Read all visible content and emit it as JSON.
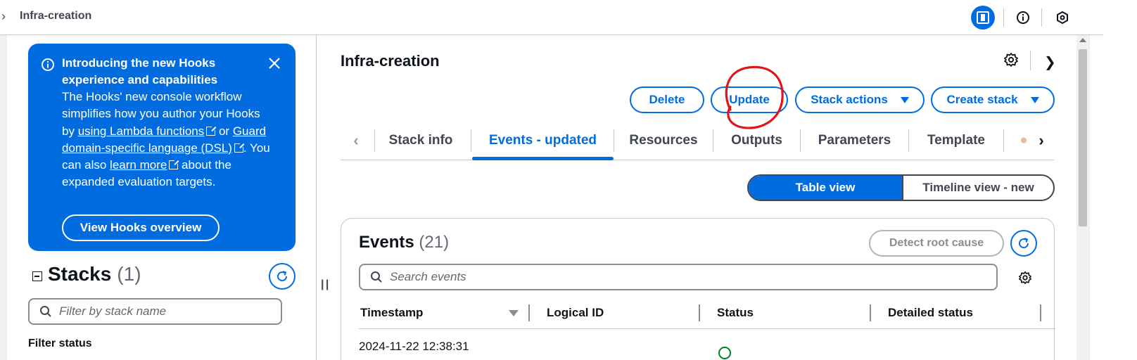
{
  "topbar": {
    "breadcrumb": "Infra-creation"
  },
  "banner": {
    "title": "Introducing the new Hooks experience and capabilities",
    "body_1": "The Hooks' new console workflow simplifies how you author your Hooks by ",
    "link_lambda": "using Lambda functions",
    "body_2": " or ",
    "link_guard": "Guard domain-specific language (DSL)",
    "body_3": ". You can also ",
    "link_learn": "learn more",
    "body_4": " about the expanded evaluation targets.",
    "button_label": "View Hooks overview"
  },
  "stacks": {
    "heading": "Stacks",
    "count": "(1)",
    "filter_placeholder": "Filter by stack name",
    "filter_status_label": "Filter status"
  },
  "main": {
    "title": "Infra-creation",
    "actions": {
      "delete": "Delete",
      "update": "Update",
      "stack_actions": "Stack actions",
      "create_stack": "Create stack"
    },
    "tabs": [
      {
        "label": "Stack info"
      },
      {
        "label": "Events - updated"
      },
      {
        "label": "Resources"
      },
      {
        "label": "Outputs"
      },
      {
        "label": "Parameters"
      },
      {
        "label": "Template"
      }
    ],
    "active_tab": "Events - updated",
    "view_toggle": {
      "table": "Table view",
      "timeline": "Timeline view - new",
      "selected": "Table view"
    }
  },
  "events": {
    "heading": "Events",
    "count": "(21)",
    "detect_root_cause": "Detect root cause",
    "search_placeholder": "Search events",
    "columns": [
      "Timestamp",
      "Logical ID",
      "Status",
      "Detailed status"
    ],
    "rows": [
      {
        "timestamp": "2024-11-22 12:38:31"
      }
    ]
  },
  "colors": {
    "accent": "#006ce0",
    "annotation": "#e0151b",
    "success": "#00802f"
  }
}
